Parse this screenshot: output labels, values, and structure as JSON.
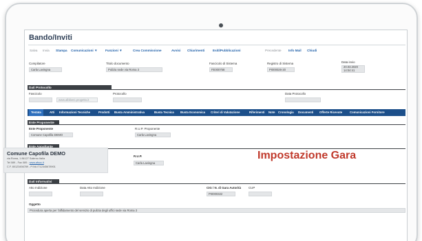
{
  "page": {
    "title": "Bando/Inviti"
  },
  "toolbar": [
    {
      "label": "Salva",
      "style": "grey"
    },
    {
      "label": "Invia",
      "style": "grey"
    },
    {
      "label": "Stampa",
      "style": "blue"
    },
    {
      "label": "Comunicazioni ▼",
      "style": "blue"
    },
    {
      "label": "Funzioni ▼",
      "style": "blue"
    },
    {
      "label": "Crea Commissione",
      "style": "blue"
    },
    {
      "label": "Avvisi",
      "style": "blue"
    },
    {
      "label": "Chiarimenti",
      "style": "blue"
    },
    {
      "label": "Esiti/Pubblicazioni",
      "style": "blue"
    },
    {
      "label": "Precedente",
      "style": "grey"
    },
    {
      "label": "Info Mail",
      "style": "blue"
    },
    {
      "label": "Chiudi",
      "style": "blue"
    }
  ],
  "header": {
    "compilatore_label": "Compilatore",
    "compilatore_value": "Carla Lavingna",
    "titolo_label": "Titolo documento",
    "titolo_value": "Pulizia sede via Roma 3",
    "fascicolo_label": "Fascicolo di Sistema",
    "fascicolo_value": "FE000758",
    "registro_label": "Registro di Sistema",
    "registro_value": "PI000026-20",
    "data_label": "Data invio",
    "data_value": "20.03.2020 14:04:41"
  },
  "protocollo": {
    "section": "Dati Protocollo",
    "fascicolo_label": "Fascicolo",
    "fascicolo_placeholder": "www.albibeni.progetto.it",
    "protocollo_label": "Protocollo",
    "data_label": "Data Protocollo"
  },
  "tabs": [
    "Testata",
    "Atti",
    "Informazioni Tecniche",
    "Prodotti",
    "Busta Amministrativa",
    "Busta Tecnica",
    "Busta Economica",
    "Criteri di Valutazione",
    "Riferimenti",
    "Note",
    "Cronologia",
    "Documenti",
    "Offerte Ricevute",
    "Comunicazioni Fornitore"
  ],
  "proponente": {
    "section": "Ente Proponente",
    "ente_label": "Ente Proponente",
    "ente_value": "Comune Capofila DEMO",
    "rup_label": "R.U.P. Proponente",
    "rup_value": "Carla Lavingna"
  },
  "appaltante": {
    "section": "Ente Appaltante",
    "name": "Comune Capofila DEMO",
    "line1": "via Roma, 1 84127 Salerno Italia",
    "line2_prefix": "Tel 089 - Fax 089 - ",
    "line2_link": "www.afsoc.it",
    "line3": "C.F. 80123456789 - P.IVA IT12345678901",
    "rup_label": "R.U.P.",
    "rup_value": "Carla Lavingna"
  },
  "overlay": {
    "text": "Impostazione Gara",
    "color": "#c0392b"
  },
  "informativi": {
    "section": "Dati Informativi",
    "atto_label": "Atto Indizione",
    "data_atto_label": "Data Atto Indizione",
    "cig_label": "CIG / N. di Gara Autorità",
    "cig_value": "PI0000322",
    "cup_label": "CUP",
    "oggetto_label": "Oggetto",
    "oggetto_value": "Procedura aperta per l'affidamento del servizio di pulizia degli uffici sede via Roma 3"
  }
}
